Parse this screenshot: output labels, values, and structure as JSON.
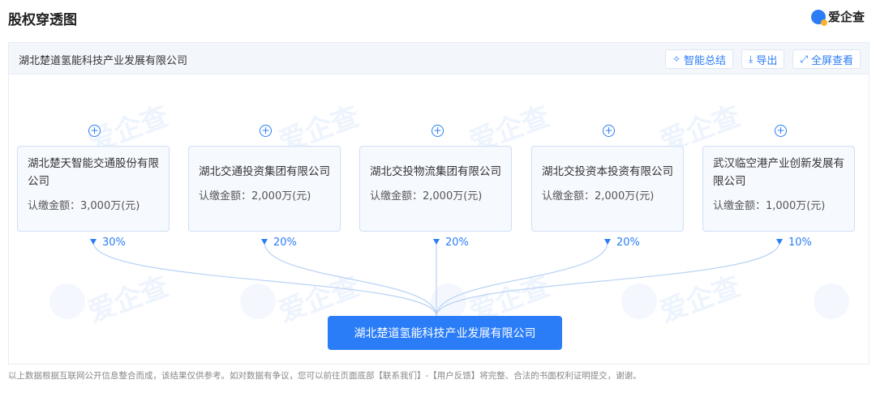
{
  "header": {
    "title": "股权穿透图",
    "brand": "爱企查"
  },
  "panel": {
    "company": "湖北楚道氢能科技产业发展有限公司"
  },
  "actions": [
    {
      "label": "智能总结",
      "icon": "sparkle-icon"
    },
    {
      "label": "导出",
      "icon": "download-icon"
    },
    {
      "label": "全屏查看",
      "icon": "fullscreen-icon"
    }
  ],
  "watermark": "爱企查",
  "shareholders": [
    {
      "name": "湖北楚天智能交通股份有限公司",
      "amount": "认缴金额：3,000万(元)",
      "percent": "30%"
    },
    {
      "name": "湖北交通投资集团有限公司",
      "amount": "认缴金额：2,000万(元)",
      "percent": "20%"
    },
    {
      "name": "湖北交投物流集团有限公司",
      "amount": "认缴金额：2,000万(元)",
      "percent": "20%"
    },
    {
      "name": "湖北交投资本投资有限公司",
      "amount": "认缴金额：2,000万(元)",
      "percent": "20%"
    },
    {
      "name": "武汉临空港产业创新发展有限公司",
      "amount": "认缴金额：1,000万(元)",
      "percent": "10%"
    }
  ],
  "target": "湖北楚道氢能科技产业发展有限公司",
  "disclaimer": "以上数据根据互联网公开信息整合而成，该结果仅供参考。如对数据有争议，您可以前往页面底部【联系我们】-【用户反馈】将完整、合法的书面权利证明提交，谢谢。"
}
